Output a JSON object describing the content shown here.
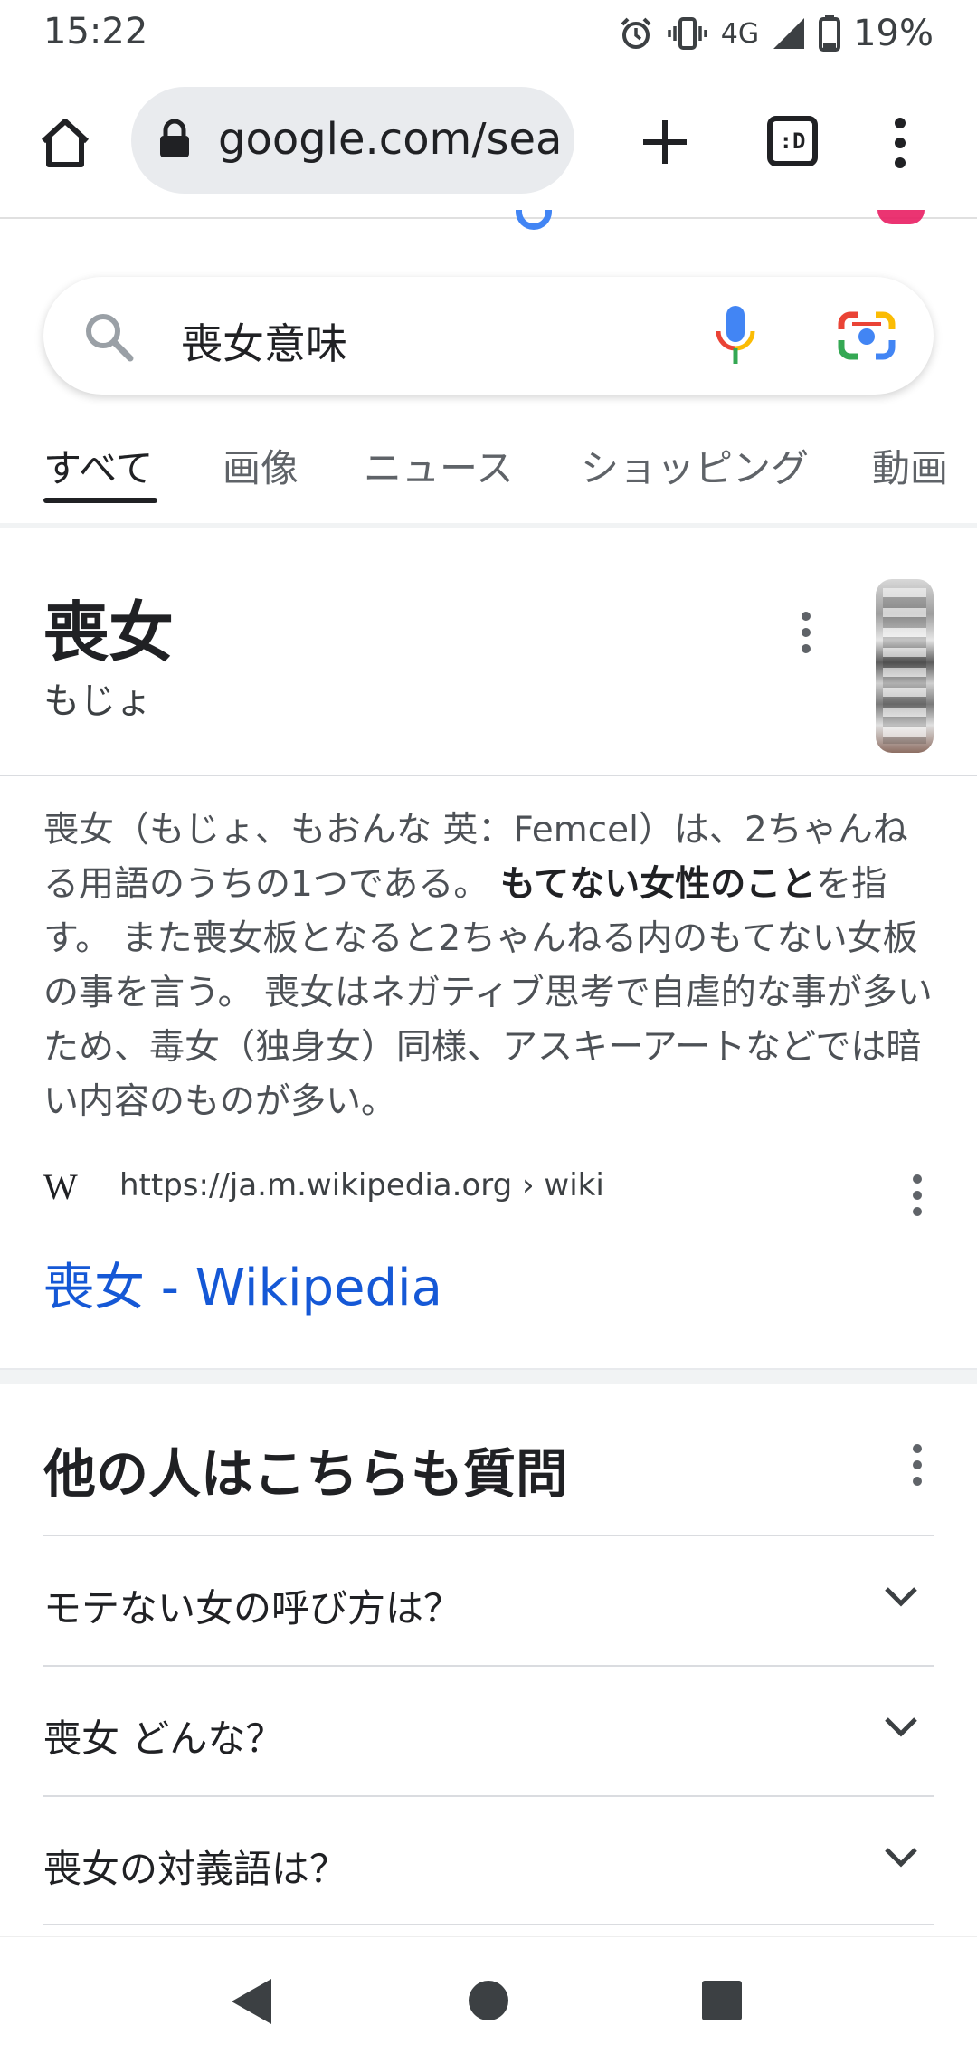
{
  "status_bar": {
    "time": "15:22",
    "network": "4G",
    "battery": "19%"
  },
  "browser": {
    "url": "google.com/search",
    "tabs_label": ":D"
  },
  "search": {
    "query": "喪女意味"
  },
  "tabs": [
    {
      "label": "すべて",
      "active": true
    },
    {
      "label": "画像"
    },
    {
      "label": "ニュース"
    },
    {
      "label": "ショッピング"
    },
    {
      "label": "動画"
    }
  ],
  "knowledge": {
    "title": "喪女",
    "reading": "もじょ",
    "snippet_part1": "喪女（もじょ、もおんな 英：Femcel）は、2ちゃんねる用語のうちの1つである。 ",
    "snippet_bold": "もてない女性のこと",
    "snippet_part2": "を指す。 また喪女板となると2ちゃんねる内のもてない女板の事を言う。 喪女はネガティブ思考で自虐的な事が多いため、毒女（独身女）同様、アスキーアートなどでは暗い内容のものが多い。",
    "source_logo": "W",
    "source_url": "https://ja.m.wikipedia.org › wiki",
    "link_title": "喪女 - Wikipedia"
  },
  "paa": {
    "title": "他の人はこちらも質問",
    "questions": [
      "モテない女の呼び方は？",
      "喪女 どんな？",
      "喪女の対義語は？"
    ]
  },
  "colors": {
    "link": "#1558d6",
    "text": "#202124",
    "muted": "#5f6368"
  }
}
